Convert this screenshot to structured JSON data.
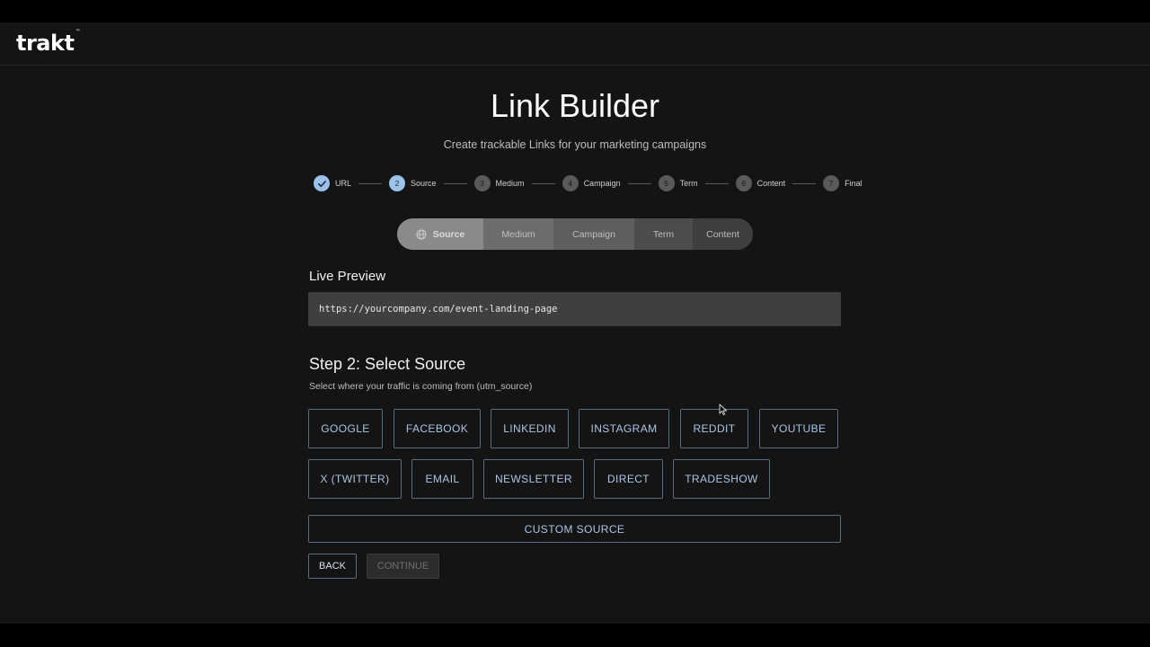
{
  "brand": {
    "logo_text": "trakt",
    "logo_mark": "™"
  },
  "page": {
    "title": "Link Builder",
    "subtitle": "Create trackable Links for your marketing campaigns"
  },
  "stepper": {
    "steps": [
      {
        "number": "1",
        "label": "URL",
        "state": "done"
      },
      {
        "number": "2",
        "label": "Source",
        "state": "active"
      },
      {
        "number": "3",
        "label": "Medium",
        "state": "pending"
      },
      {
        "number": "4",
        "label": "Campaign",
        "state": "pending"
      },
      {
        "number": "5",
        "label": "Term",
        "state": "pending"
      },
      {
        "number": "6",
        "label": "Content",
        "state": "pending"
      },
      {
        "number": "7",
        "label": "Final",
        "state": "pending"
      }
    ]
  },
  "tabs": [
    {
      "label": "Source",
      "icon": "globe-icon",
      "active": true
    },
    {
      "label": "Medium"
    },
    {
      "label": "Campaign"
    },
    {
      "label": "Term"
    },
    {
      "label": "Content"
    }
  ],
  "preview": {
    "heading": "Live Preview",
    "url": "https://yourcompany.com/event-landing-page"
  },
  "source_step": {
    "title": "Step 2: Select Source",
    "description": "Select where your traffic is coming from (utm_source)",
    "options": [
      "GOOGLE",
      "FACEBOOK",
      "LINKEDIN",
      "INSTAGRAM",
      "REDDIT",
      "YOUTUBE",
      "X (TWITTER)",
      "EMAIL",
      "NEWSLETTER",
      "DIRECT",
      "TRADESHOW"
    ],
    "custom_label": "CUSTOM SOURCE"
  },
  "actions": {
    "back": "BACK",
    "continue": "CONTINUE"
  },
  "colors": {
    "accent": "#9cc2ea",
    "button_text": "#a9c6e6",
    "background": "#141414"
  }
}
